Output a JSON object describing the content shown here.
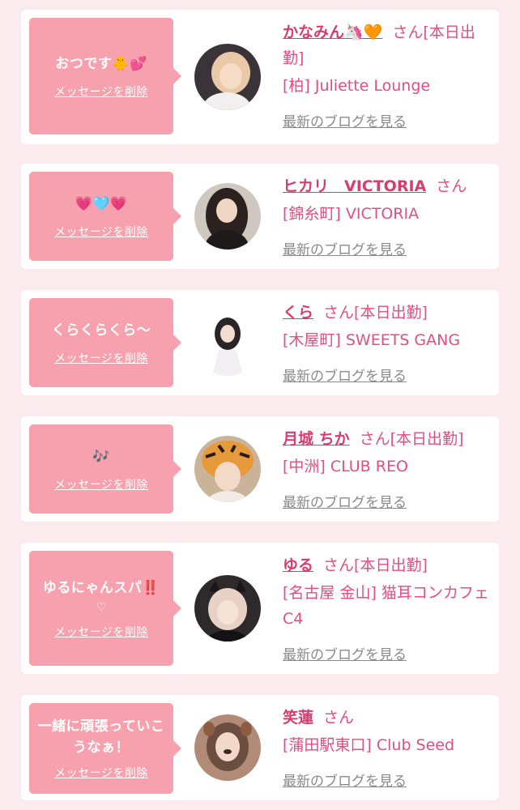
{
  "delete_label": "メッセージを削除",
  "blog_label": "最新のブログを見る",
  "cards": [
    {
      "message": "おつです🐥💕",
      "name": "かなみん🦄🧡",
      "honorific": "さん",
      "shift": "[本日出勤]",
      "shop": "[柏] Juliette Lounge"
    },
    {
      "message": "💗🩵💗",
      "name": "ヒカリ　VICTORIA",
      "honorific": "さん",
      "shift": "",
      "shop": "[錦糸町] VICTORIA"
    },
    {
      "message": "くらくらくら〜",
      "name": "くら",
      "honorific": "さん",
      "shift": "[本日出勤]",
      "shop": "[木屋町] SWEETS GANG"
    },
    {
      "message": "🎶",
      "name": "月城 ちか",
      "honorific": "さん",
      "shift": "[本日出勤]",
      "shop": "[中洲] CLUB REO"
    },
    {
      "message": "ゆるにゃんスパ‼️",
      "message_sub": "♡",
      "name": "ゆる",
      "honorific": "さん",
      "shift": "[本日出勤]",
      "shop": "[名古屋 金山] 猫耳コンカフェ C4"
    },
    {
      "message": "一緒に頑張っていこうなぁ！",
      "name": "笑蓮",
      "honorific": "さん",
      "shift": "",
      "shop": "[蒲田駅東口] Club Seed"
    }
  ],
  "colors": {
    "page_bg": "#fcebee",
    "bubble": "#f8a1ae",
    "accent": "#e04f80",
    "muted": "#8a8a8a"
  }
}
